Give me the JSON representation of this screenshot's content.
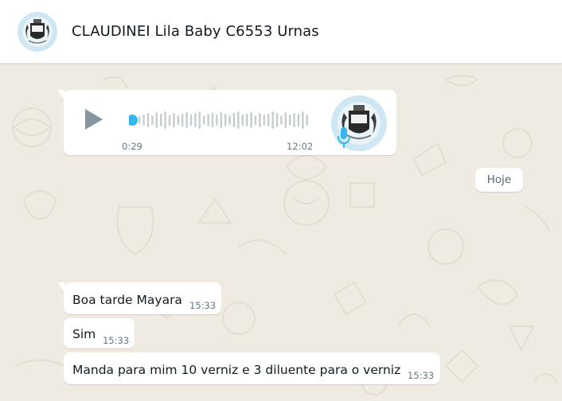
{
  "contact": {
    "name": "CLAUDINEI Lila Baby C6553 Urnas"
  },
  "audio_message": {
    "duration": "0:29",
    "time": "12:02",
    "progress": 0
  },
  "date_divider": "Hoje",
  "messages": [
    {
      "text": "Boa tarde Mayara",
      "time": "15:33"
    },
    {
      "text": "Sim",
      "time": "15:33"
    },
    {
      "text": "Manda para mim 10 verniz e 3 diluente para o verniz",
      "time": "15:33"
    }
  ],
  "colors": {
    "header_bg": "#ffffff",
    "chat_bg": "#efeae2",
    "bubble_bg": "#ffffff",
    "accent_blue": "#34b7f1",
    "play_gray": "#8696a0",
    "time_gray": "#667781"
  },
  "icons": {
    "play": "play-icon",
    "mic": "mic-icon",
    "avatar": "contact-avatar"
  }
}
